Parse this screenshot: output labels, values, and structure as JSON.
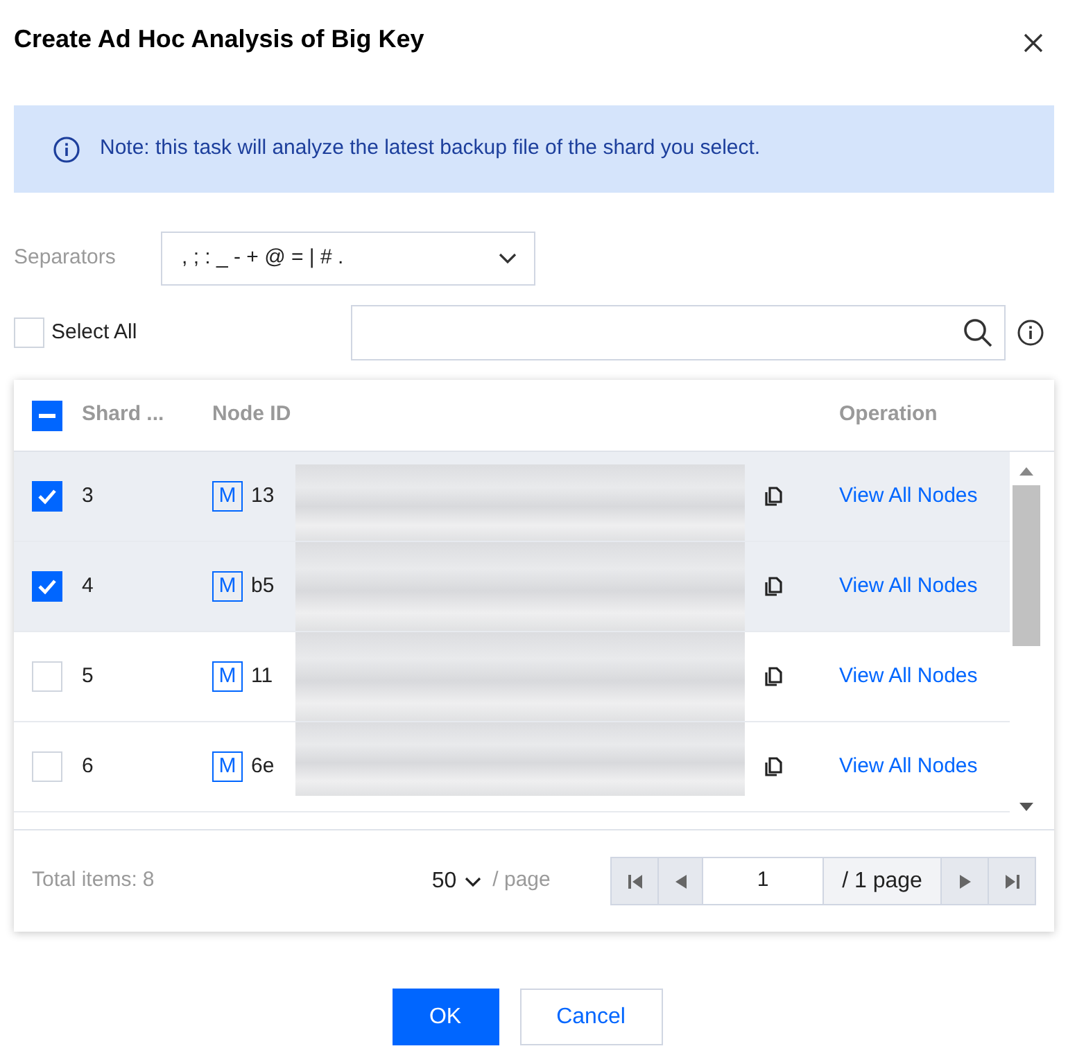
{
  "dialog": {
    "title": "Create Ad Hoc Analysis of Big Key"
  },
  "note": "Note: this task will analyze the latest backup file of the shard you select.",
  "separators": {
    "label": "Separators",
    "value": ", ; : _ - + @ = | # ."
  },
  "select_all": {
    "label": "Select All",
    "checked": false
  },
  "table": {
    "header_indeterminate": true,
    "columns": [
      "Shard ...",
      "Node ID",
      "Operation"
    ],
    "rows": [
      {
        "shard": "3",
        "badge": "M",
        "node_id_start": "13",
        "operation": "View All Nodes",
        "checked": true
      },
      {
        "shard": "4",
        "badge": "M",
        "node_id_start": "b5",
        "operation": "View All Nodes",
        "checked": true
      },
      {
        "shard": "5",
        "badge": "M",
        "node_id_start": "11",
        "operation": "View All Nodes",
        "checked": false
      },
      {
        "shard": "6",
        "badge": "M",
        "node_id_start": "6e",
        "operation": "View All Nodes",
        "checked": false
      }
    ]
  },
  "pagination": {
    "total_label": "Total items:",
    "total": "8",
    "page_size": "50",
    "per_page": "/ page",
    "page": "1",
    "page_count": "/ 1 page"
  },
  "buttons": {
    "ok": "OK",
    "cancel": "Cancel"
  }
}
